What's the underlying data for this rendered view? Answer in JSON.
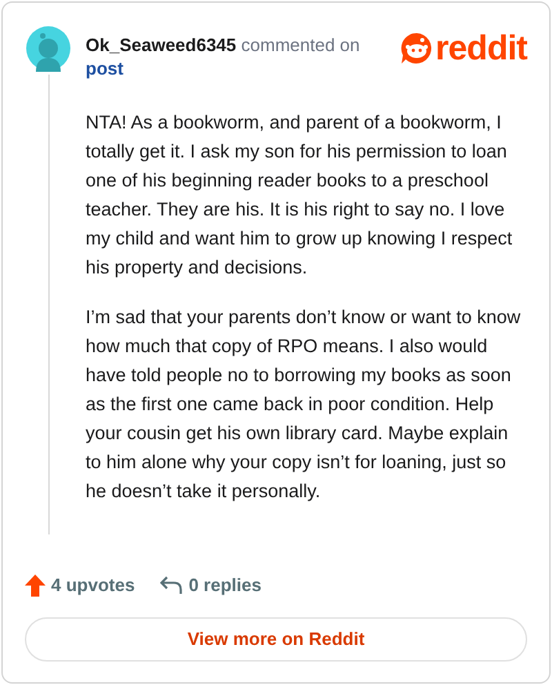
{
  "comment": {
    "author": "Ok_Seaweed6345",
    "action": "commented on",
    "target": "post"
  },
  "logo": {
    "text": "reddit"
  },
  "paragraphs": [
    "NTA! As a bookworm, and parent of a bookworm, I totally get it. I ask my son for his permission to loan one of his beginning reader books to a preschool teacher. They are his. It is his right to say no. I love my child and want him to grow up knowing I respect his property and decisions.",
    "I’m sad that your parents don’t know or want to know how much that copy of RPO means. I also would have told people no to borrowing my books as soon as the first one came back in poor condition. Help your cousin get his own library card. Maybe explain to him alone why your copy isn’t for loaning, just so he doesn’t take it personally."
  ],
  "stats": {
    "upvotes": "4 upvotes",
    "replies": "0 replies"
  },
  "button": "View more on Reddit"
}
